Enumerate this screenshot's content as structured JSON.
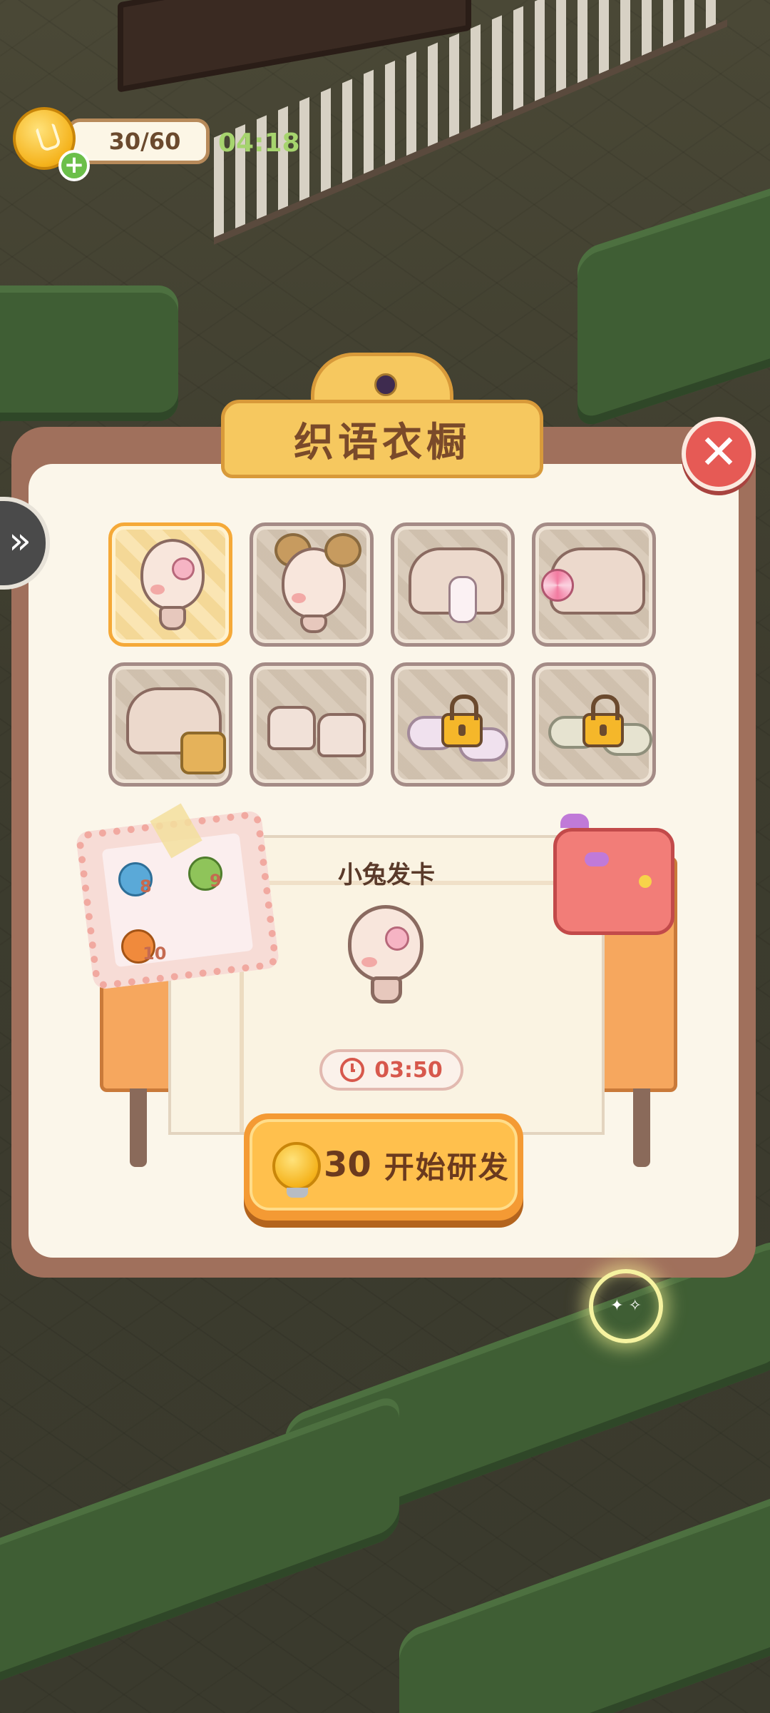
{
  "hud": {
    "energy_text": "30/60",
    "timer": "04:18",
    "plus_symbol": "+"
  },
  "panel": {
    "title": "织语衣橱",
    "close_symbol": "✕",
    "side_arrow_symbol": "»"
  },
  "items": [
    {
      "icon": "bunny-hairclip-head-icon",
      "selected": true,
      "locked": false
    },
    {
      "icon": "bun-hairstyle-head-icon",
      "selected": false,
      "locked": false
    },
    {
      "icon": "bunny-plush-sweater-icon",
      "selected": false,
      "locked": false
    },
    {
      "icon": "lollipop-sweater-icon",
      "selected": false,
      "locked": false
    },
    {
      "icon": "basket-sweater-icon",
      "selected": false,
      "locked": false
    },
    {
      "icon": "lace-up-boots-icon",
      "selected": false,
      "locked": false
    },
    {
      "icon": "bunny-slippers-icon",
      "selected": false,
      "locked": true
    },
    {
      "icon": "cloud-slippers-icon",
      "selected": false,
      "locked": true
    }
  ],
  "workbench": {
    "item_name": "小兔发卡",
    "research_time": "03:50",
    "materials": [
      {
        "icon": "yarn-ball-icon",
        "count": "8",
        "color": "#5aa9d8"
      },
      {
        "icon": "scissors-icon",
        "count": "9",
        "color": "#8fc45a"
      },
      {
        "icon": "button-icon",
        "count": "10",
        "color": "#f08a3c"
      }
    ],
    "start_button": {
      "cost": "30",
      "label": "开始研发"
    }
  },
  "colors": {
    "panel_border": "#a0705c",
    "panel_fill": "#fbf6ea",
    "title_plaque": "#f6c85f",
    "close_button": "#e65a55",
    "start_button": "#ffc04d",
    "timer_text": "#a6d46e",
    "selected_cell": "#f9dc9a"
  }
}
